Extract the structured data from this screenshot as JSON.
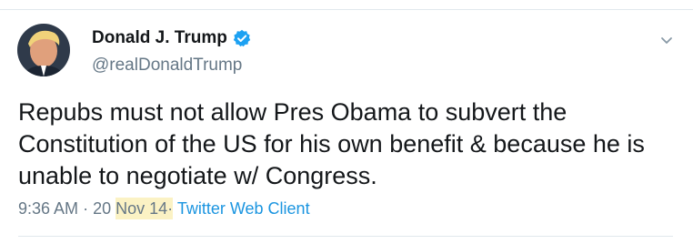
{
  "tweet": {
    "author": {
      "display_name": "Donald J. Trump",
      "handle": "@realDonaldTrump",
      "verified_icon": "verified-badge-icon",
      "avatar_icon": "profile-photo"
    },
    "text": "Repubs must not allow Pres Obama to subvert the\nConstitution of the US for his own benefit & because he is\nunable to negotiate w/ Congress.",
    "meta": {
      "time": "9:36 AM",
      "separator": "·",
      "day": "20",
      "month_year": "Nov 14",
      "source": "Twitter Web Client"
    },
    "menu_icon": "chevron-down-icon"
  },
  "colors": {
    "text": "#14171a",
    "secondary": "#657786",
    "link": "#1b95e0",
    "verified": "#1da1f2",
    "highlight": "#fbf2c4",
    "divider": "#e1e8ed"
  }
}
